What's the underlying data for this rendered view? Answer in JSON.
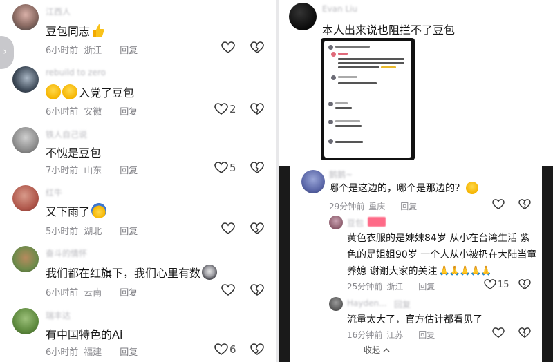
{
  "left_comments": [
    {
      "username": "江西人",
      "text": "豆包同志",
      "emoji": "👍",
      "time": "6小时前",
      "location": "浙江",
      "reply": "回复",
      "likes": ""
    },
    {
      "username": "rebuild to zero",
      "text": "入党了豆包",
      "emoji_prefix": "😂😂",
      "time": "6小时前",
      "location": "安徽",
      "reply": "回复",
      "likes": "2"
    },
    {
      "username": "铁人自己说",
      "text": "不愧是豆包",
      "time": "7小时前",
      "location": "山东",
      "reply": "回复",
      "likes": "5"
    },
    {
      "username": "红牛",
      "text": "又下雨了",
      "emoji": "😂",
      "time": "5小时前",
      "location": "湖北",
      "reply": "回复",
      "likes": ""
    },
    {
      "username": "奋斗的情怀",
      "text": "我们都在红旗下，我们心里有数",
      "emoji": "🦝",
      "time": "6小时前",
      "location": "云南",
      "reply": "回复",
      "likes": ""
    },
    {
      "username": "瑞丰达",
      "text": "有中国特色的Ai",
      "time": "6小时前",
      "location": "福建",
      "reply": "回复",
      "likes": "6"
    }
  ],
  "right_top": {
    "username": "Evan Liu",
    "text": "本人出来说也阻拦不了豆包"
  },
  "right_bottom": {
    "comment1": {
      "username": "鹅鹅~",
      "text": "哪个是这边的，哪个是那边的？",
      "emoji": "😂",
      "time": "29分钟前",
      "location": "重庆",
      "reply": "回复"
    },
    "comment2": {
      "username": "豆包",
      "text_line1": "黄色衣服的是妹妹84岁 从小在台湾生活 紫",
      "text_line2": "色的是姐姐90岁 一个人从小被扔在大陆当童",
      "text_line3": "养媳 谢谢大家的关注",
      "emoji": "🙏🙏🙏🙏🙏",
      "time": "25分钟前",
      "location": "浙江",
      "reply": "回复",
      "likes": "15"
    },
    "comment3": {
      "username": "Hayden... ",
      "username_tag": "回复",
      "text": "流量太大了，官方估计都看见了",
      "time": "16分钟前",
      "location": "江苏",
      "reply": "回复"
    },
    "collapse": "收起"
  },
  "colors": {
    "accent": "#fe2c55",
    "muted": "#8a8a8f"
  }
}
